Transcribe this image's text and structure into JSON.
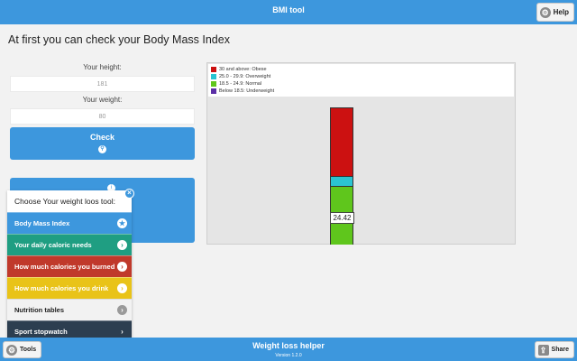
{
  "header": {
    "title": "BMI tool",
    "help_label": "Help",
    "help_icon": "gear-icon"
  },
  "main": {
    "heading": "At first you can check your Body Mass Index",
    "height_label": "Your height:",
    "height_value": "181",
    "weight_label": "Your weight:",
    "weight_value": "80",
    "check_label": "Check",
    "check_icon": "search-icon",
    "result_icon": "info-icon"
  },
  "chart": {
    "legend": [
      {
        "label": "30 and above: Obese",
        "color": "#cc1111"
      },
      {
        "label": "25.0 - 29.9: Overweight",
        "color": "#2bc4d1"
      },
      {
        "label": "18.5 - 24.9: Normal",
        "color": "#5fc61c"
      },
      {
        "label": "Below 18.5: Underweight",
        "color": "#5b2fa6"
      }
    ],
    "bmi_value": "24.42"
  },
  "menu": {
    "title": "Choose Your weight loos tool:",
    "items": [
      {
        "label": "Body Mass Index",
        "color": "#3d97dd",
        "icon": "star-icon"
      },
      {
        "label": "Your daily caloric needs",
        "color": "#1f9e82",
        "icon": "chevron-right-icon"
      },
      {
        "label": "How much calories you burned",
        "color": "#c0392b",
        "icon": "chevron-right-icon"
      },
      {
        "label": "How much calories you drink",
        "color": "#e9c318",
        "icon": "chevron-right-icon"
      },
      {
        "label": "Nutrition tables",
        "color": "#f2f2f2",
        "icon": "chevron-right-icon"
      },
      {
        "label": "Sport stopwatch",
        "color": "#2c3e50",
        "icon": "chevron-right-icon"
      }
    ]
  },
  "footer": {
    "title": "Weight loss helper",
    "version": "Version 1.2.0",
    "tools_label": "Tools",
    "share_label": "Share"
  }
}
